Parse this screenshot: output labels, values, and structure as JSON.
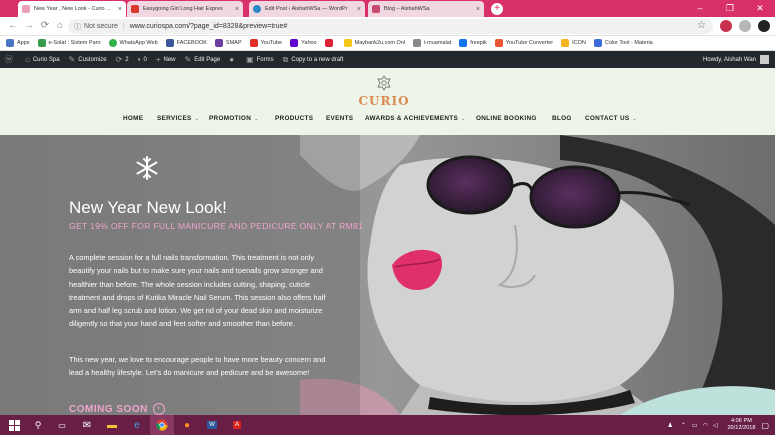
{
  "browser": {
    "tabs": [
      {
        "title": "New Year , New Look - Curio Spa",
        "favicon_color": "#e8a0b8"
      },
      {
        "title": "Easygoing Girl Long Hair Expres",
        "favicon_color": "#d9382e"
      },
      {
        "title": "Edit Post ‹ AishahWSa — WordPr",
        "favicon_color": "#2b8ac6"
      },
      {
        "title": "Blog – AishahWSa",
        "favicon_color": "#c94c6e"
      }
    ],
    "security_label": "Not secure",
    "url": "www.curiospa.com/?page_id=8328&preview=true#",
    "bookmarks": [
      {
        "label": "Apps",
        "color": "#4a78c4"
      },
      {
        "label": "e-Solat : Sistem Paro",
        "color": "#3a9b4c"
      },
      {
        "label": "WhatsApp Web",
        "color": "#30b14a"
      },
      {
        "label": "FACEBOOK",
        "color": "#3b5998"
      },
      {
        "label": "SMAP",
        "color": "#6b3fa0"
      },
      {
        "label": "YouTube",
        "color": "#e52d27"
      },
      {
        "label": "Yahoo",
        "color": "#5f01d1"
      },
      {
        "label": "",
        "color": "#d23"
      },
      {
        "label": "Maybank2u.com Onl",
        "color": "#f5c518"
      },
      {
        "label": "i-muamalat",
        "color": "#888"
      },
      {
        "label": "freepik",
        "color": "#1273eb"
      },
      {
        "label": "YouTube Converter",
        "color": "#e53"
      },
      {
        "label": "ICON",
        "color": "#f3b220"
      },
      {
        "label": "Color Tool - Materia",
        "color": "#3b6bd6"
      }
    ]
  },
  "wp_admin_bar": {
    "site_name": "Curio Spa",
    "customize": "Customize",
    "updates": "2",
    "comments": "0",
    "new_label": "New",
    "edit_page": "Edit Page",
    "forms": "Forms",
    "copy_draft": "Copy to a new draft",
    "howdy": "Howdy, Aishah Wan"
  },
  "site": {
    "logo_text": "CURIO",
    "nav": [
      "HOME",
      "SERVICES",
      "PROMOTION",
      "PRODUCTS",
      "EVENTS",
      "AWARDS & ACHIEVEMENTS",
      "ONLINE BOOKING",
      "BLOG",
      "CONTACT US"
    ],
    "nav_accent": "#d98a4f"
  },
  "hero": {
    "title": "New Year New Look!",
    "subtitle": "GET 19% OFF FOR FULL MANICURE AND PEDICURE ONLY AT RM81",
    "paragraph1": "A complete session for a full nails transformation. This treatment is not only beautify your nails but to make sure your nails and toenails grow stronger and healthier than before. The whole session includes cutting, shaping, cuticle treatment and drops of Kutika Miracle Nail Serum. This session also offers half arm and half leg scrub and lotion. We get rid of your dead skin and moisturize diligently so that your hand and feet softer and smoother than before.",
    "paragraph2": "This new year, we love to encourage people to have more beauty concern and lead a healthy lifestyle. Let’s do manicure and pedicure and be awesome!",
    "cta": "COMING SOON",
    "accent": "#f0a4cc"
  },
  "taskbar": {
    "time": "4:06 PM",
    "date": "20/12/2018",
    "color": "#681f45"
  }
}
